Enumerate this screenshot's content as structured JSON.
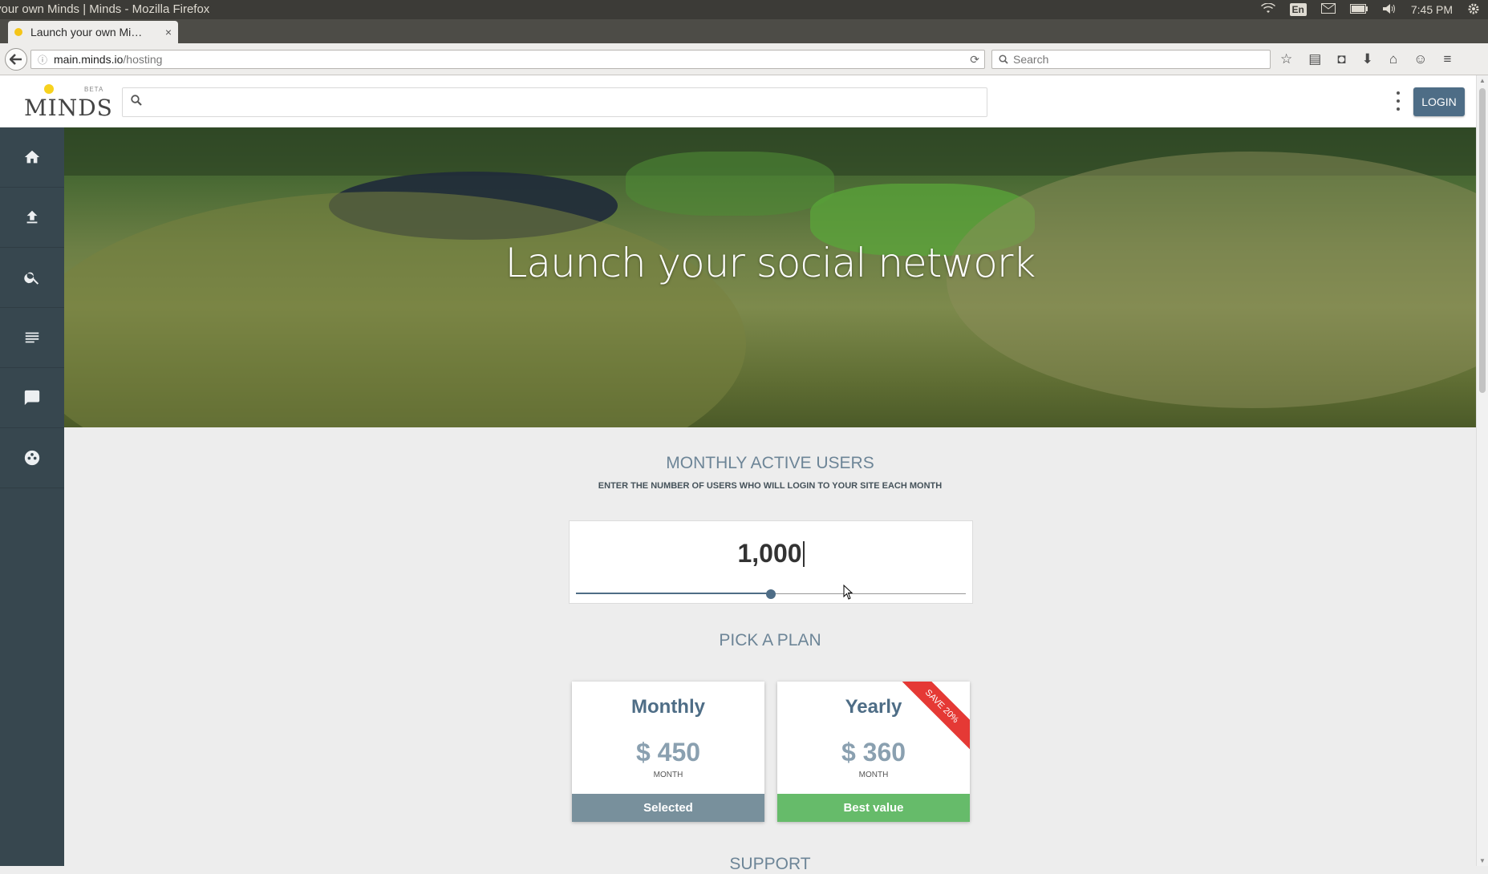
{
  "os": {
    "window_title": "your own Minds | Minds - Mozilla Firefox",
    "lang": "En",
    "time": "7:45 PM"
  },
  "browser": {
    "tab_title": "Launch your own Mi…",
    "tab_close": "×",
    "new_tab": "+",
    "url_host": "main.minds.io",
    "url_path": "/hosting",
    "search_placeholder": "Search"
  },
  "header": {
    "logo_text": "MINDS",
    "logo_badge": "BETA",
    "login_label": "LOGIN",
    "search_placeholder": ""
  },
  "sidebar": {
    "items": [
      {
        "name": "home-icon"
      },
      {
        "name": "upload-icon"
      },
      {
        "name": "search-icon"
      },
      {
        "name": "newsfeed-icon"
      },
      {
        "name": "chat-icon"
      },
      {
        "name": "groups-icon"
      }
    ]
  },
  "hero": {
    "title": "Launch your social network"
  },
  "users": {
    "title": "MONTHLY ACTIVE USERS",
    "subtitle": "ENTER THE NUMBER OF USERS WHO WILL LOGIN TO YOUR SITE EACH MONTH",
    "value": "1,000",
    "slider_fraction": 0.5
  },
  "plans": {
    "title": "PICK A PLAN",
    "items": [
      {
        "name": "Monthly",
        "price": "$ 450",
        "period": "MONTH",
        "footer": "Selected",
        "footer_color": "#78909c"
      },
      {
        "name": "Yearly",
        "price": "$ 360",
        "period": "MONTH",
        "footer": "Best value",
        "footer_color": "#66bb6a",
        "ribbon": "SAVE 20%"
      }
    ]
  },
  "support": {
    "title": "SUPPORT"
  },
  "colors": {
    "accent": "#4e6d86",
    "sidebar_bg": "#37474f",
    "selected": "#78909c",
    "best_value": "#66bb6a",
    "ribbon": "#e53935"
  }
}
